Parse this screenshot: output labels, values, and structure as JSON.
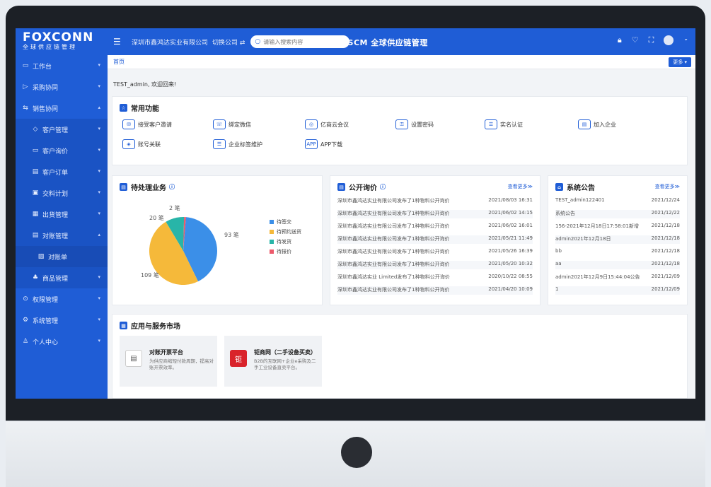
{
  "sidebar": {
    "logo": "FOXCONN",
    "logo_sub": "全球供应链管理",
    "items": [
      {
        "label": "工作台",
        "icon": "▭",
        "level": 0,
        "arrow": "▾"
      },
      {
        "label": "采购协同",
        "icon": "▷",
        "level": 0,
        "arrow": "▾"
      },
      {
        "label": "销售协同",
        "icon": "⇆",
        "level": 0,
        "arrow": "▴"
      },
      {
        "label": "客户管理",
        "icon": "◇",
        "level": 1,
        "arrow": "▾"
      },
      {
        "label": "客户询价",
        "icon": "▭",
        "level": 1,
        "arrow": "▾"
      },
      {
        "label": "客户订单",
        "icon": "▤",
        "level": 1,
        "arrow": "▾"
      },
      {
        "label": "交料计划",
        "icon": "▣",
        "level": 1,
        "arrow": "▾"
      },
      {
        "label": "出货管理",
        "icon": "▦",
        "level": 1,
        "arrow": "▾"
      },
      {
        "label": "对账管理",
        "icon": "▤",
        "level": 1,
        "arrow": "▴"
      },
      {
        "label": "对账单",
        "icon": "▧",
        "level": 2,
        "arrow": ""
      },
      {
        "label": "商品管理",
        "icon": "♣",
        "level": 1,
        "arrow": "▾"
      },
      {
        "label": "权限管理",
        "icon": "⊙",
        "level": 0,
        "arrow": "▾"
      },
      {
        "label": "系统管理",
        "icon": "⚙",
        "level": 0,
        "arrow": "▾"
      },
      {
        "label": "个人中心",
        "icon": "♙",
        "level": 0,
        "arrow": "▾"
      }
    ]
  },
  "topbar": {
    "company": "深圳市鑫鸿达实业有限公司",
    "switch_label": "切换公司 ⇄",
    "search_placeholder": "请输入搜索内容",
    "title": "GSCM 全球供应链管理",
    "icons": [
      "lock-icon",
      "bell-icon",
      "expand-icon"
    ]
  },
  "breadcrumb": {
    "home": "首页",
    "more": "更多 ▾"
  },
  "welcome": "TEST_admin, 欢迎回来!",
  "common": {
    "title": "常用功能",
    "items": [
      {
        "label": "接受客户邀请",
        "icon": "✉"
      },
      {
        "label": "绑定微信",
        "icon": "☏"
      },
      {
        "label": "亿商云会议",
        "icon": "◎"
      },
      {
        "label": "设置密码",
        "icon": "⚿"
      },
      {
        "label": "实名认证",
        "icon": "☰"
      },
      {
        "label": "加入企业",
        "icon": "▤"
      },
      {
        "label": "账号关联",
        "icon": "◈"
      },
      {
        "label": "企业标签维护",
        "icon": "☰"
      },
      {
        "label": "APP下载",
        "icon": "APP"
      }
    ]
  },
  "pending": {
    "title": "待处理业务",
    "labels": [
      "93 笔",
      "109 笔",
      "20 笔",
      "2 笔"
    ],
    "legend": [
      {
        "label": "待签交",
        "color": "#3b8fe8"
      },
      {
        "label": "待预约送货",
        "color": "#f5b93a"
      },
      {
        "label": "待发货",
        "color": "#28b5a8"
      },
      {
        "label": "待报价",
        "color": "#ec5a6b"
      }
    ]
  },
  "chart_data": {
    "type": "pie",
    "categories": [
      "待签交",
      "待预约送货",
      "待发货",
      "待报价"
    ],
    "values": [
      93,
      109,
      20,
      2
    ],
    "colors": [
      "#3b8fe8",
      "#f5b93a",
      "#28b5a8",
      "#ec5a6b"
    ]
  },
  "inquiry": {
    "title": "公开询价",
    "more": "查看更多≫",
    "rows": [
      {
        "text": "深圳市鑫鸿达实业有限公司发布了1种物料公开询价",
        "date": "2021/08/03 16:31"
      },
      {
        "text": "深圳市鑫鸿达实业有限公司发布了1种物料公开询价",
        "date": "2021/06/02 14:15"
      },
      {
        "text": "深圳市鑫鸿达实业有限公司发布了1种物料公开询价",
        "date": "2021/06/02 16:01"
      },
      {
        "text": "深圳市鑫鸿达实业有限公司发布了1种物料公开询价",
        "date": "2021/05/21 11:49"
      },
      {
        "text": "深圳市鑫鸿达实业有限公司发布了1种物料公开询价",
        "date": "2021/05/26 16:39"
      },
      {
        "text": "深圳市鑫鸿达实业有限公司发布了1种物料公开询价",
        "date": "2021/05/20 10:32"
      },
      {
        "text": "深圳市鑫鸿达实业 Limited发布了1种物料公开询价",
        "date": "2020/10/22 08:55"
      },
      {
        "text": "深圳市鑫鸿达实业有限公司发布了1种物料公开询价",
        "date": "2021/04/20 10:09"
      }
    ]
  },
  "notice": {
    "title": "系统公告",
    "more": "查看更多≫",
    "rows": [
      {
        "text": "TEST_admin122401",
        "date": "2021/12/24"
      },
      {
        "text": "系统公告",
        "date": "2021/12/22"
      },
      {
        "text": "156-2021年12月18日17:58:01新增",
        "date": "2021/12/18"
      },
      {
        "text": "admin2021年12月18日",
        "date": "2021/12/18"
      },
      {
        "text": "bb",
        "date": "2021/12/18"
      },
      {
        "text": "aa",
        "date": "2021/12/18"
      },
      {
        "text": "admin2021年12月9日15:44:04公告",
        "date": "2021/12/09"
      },
      {
        "text": "1",
        "date": "2021/12/09"
      }
    ]
  },
  "apps": {
    "title": "应用与服务市场",
    "cards": [
      {
        "title": "对账开票平台",
        "desc": "为供应商缩短付款周期，提高对账开票效率。",
        "icon": "▤"
      },
      {
        "title": "钜商网（二手设备买卖）",
        "desc": "B2B的互联网+企业e采购及二手工业设备直卖平台。",
        "icon": "钜"
      }
    ]
  }
}
